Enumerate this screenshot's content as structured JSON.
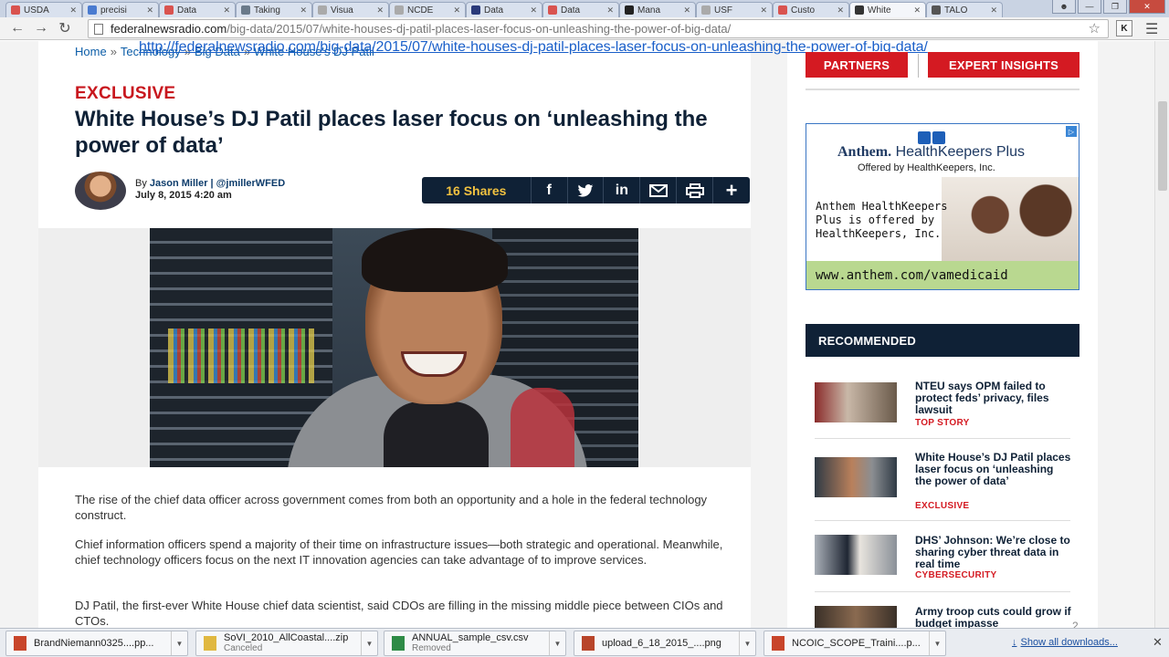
{
  "browser": {
    "tabs": [
      {
        "label": "USDA",
        "color": "#d9534f"
      },
      {
        "label": "precisi",
        "color": "#4a7bd0"
      },
      {
        "label": "Data",
        "color": "#d9534f"
      },
      {
        "label": "Taking",
        "color": "#6a7a8a"
      },
      {
        "label": "Visua",
        "color": "#aaaaaa"
      },
      {
        "label": "NCDE",
        "color": "#aaaaaa"
      },
      {
        "label": "Data",
        "color": "#2a3a7a"
      },
      {
        "label": "Data",
        "color": "#d9534f"
      },
      {
        "label": "Mana",
        "color": "#222222"
      },
      {
        "label": "USF",
        "color": "#aaaaaa"
      },
      {
        "label": "Custo",
        "color": "#d9534f"
      },
      {
        "label": "White",
        "color": "#333333",
        "active": true
      },
      {
        "label": "TALO",
        "color": "#555555"
      }
    ],
    "url_host": "federalnewsradio.com",
    "url_path": "/big-data/2015/07/white-houses-dj-patil-places-laser-focus-on-unleashing-the-power-of-big-data/"
  },
  "overlay_url": "http://federalnewsradio.com/big-data/2015/07/white-houses-dj-patil-places-laser-focus-on-unleashing-the-power-of-big-data/",
  "breadcrumb": {
    "home": "Home",
    "technology": "Technology",
    "big_data": "Big Data",
    "current": "White House's DJ Patil"
  },
  "article": {
    "kicker": "EXCLUSIVE",
    "headline": "White House’s DJ Patil places laser focus on ‘unleashing the power of data’",
    "byline_prefix": "By",
    "author": "Jason Miller | @jmillerWFED",
    "date": "July 8, 2015 4:20 am",
    "share_count": "16 Shares",
    "paragraphs": [
      "The rise of the chief data officer across government comes from both an opportunity and a hole in the federal technology construct.",
      "Chief information officers spend a majority of their time on infrastructure issues—both strategic and operational. Meanwhile, chief technology officers focus on the next IT innovation agencies can take advantage of to improve services.",
      "DJ Patil, the first-ever White House chief data scientist, said CDOs are filling in the missing middle piece between CIOs and CTOs."
    ]
  },
  "sidebar": {
    "partners": "PARTNERS",
    "expert": "EXPERT INSIGHTS",
    "ad": {
      "brand_bold": "Anthem.",
      "brand_rest": "HealthKeepers Plus",
      "sub": "Offered by HealthKeepers, Inc.",
      "body_lines": [
        "Anthem HealthKeepers",
        "Plus is offered by",
        "HealthKeepers, Inc."
      ],
      "url": "www.anthem.com/vamedicaid"
    },
    "recommended": "RECOMMENDED",
    "items": [
      {
        "title": "NTEU says OPM failed to protect feds’ privacy, files lawsuit",
        "tag": "TOP STORY"
      },
      {
        "title": "White House’s DJ Patil places laser focus on ‘unleashing the power of data’",
        "tag": "EXCLUSIVE"
      },
      {
        "title": "DHS’ Johnson: We’re close to sharing cyber threat data in real time",
        "tag": "CYBERSECURITY"
      },
      {
        "title": "Army troop cuts could grow if budget impasse",
        "tag": ""
      }
    ]
  },
  "slide_number": "2",
  "downloads": {
    "items": [
      {
        "name": "BrandNiemann0325....pp...",
        "status": "",
        "color": "#c8452a"
      },
      {
        "name": "SoVI_2010_AllCoastal....zip",
        "status": "Canceled",
        "color": "#e0b840"
      },
      {
        "name": "ANNUAL_sample_csv.csv",
        "status": "Removed",
        "color": "#2e8b46"
      },
      {
        "name": "upload_6_18_2015_....png",
        "status": "",
        "color": "#b8452a"
      },
      {
        "name": "NCOIC_SCOPE_Traini....p...",
        "status": "",
        "color": "#c8452a"
      }
    ],
    "show_all": "Show all downloads..."
  }
}
